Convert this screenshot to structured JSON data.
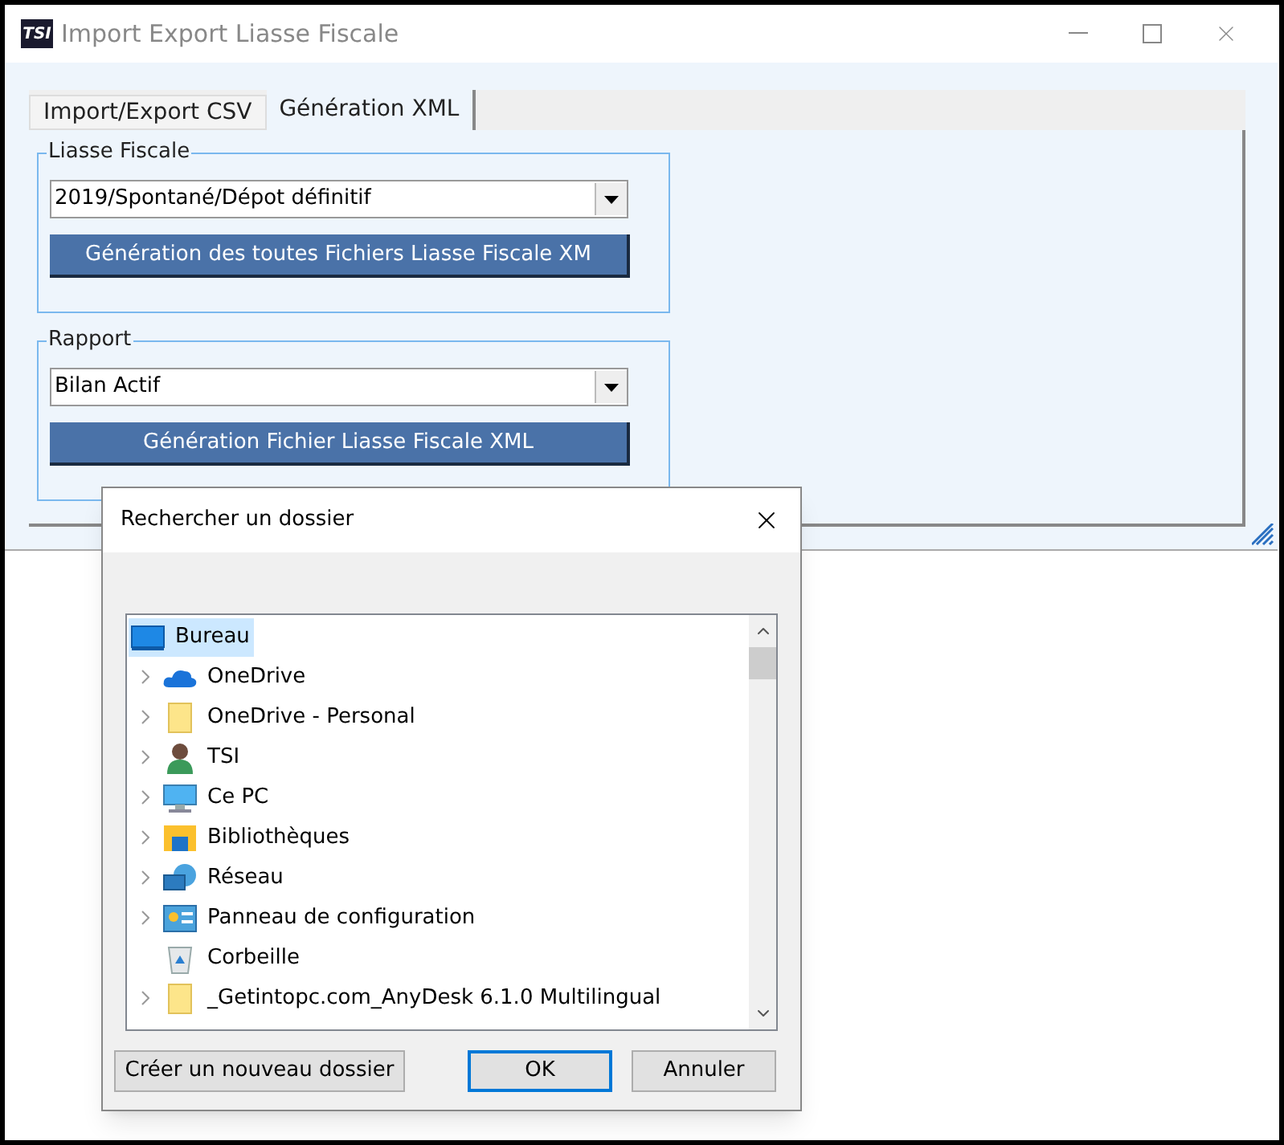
{
  "window": {
    "title": "Import Export Liasse Fiscale",
    "logo": "TSI"
  },
  "tabs": [
    {
      "label": "Import/Export CSV",
      "selected": false
    },
    {
      "label": "Génération XML",
      "selected": true
    }
  ],
  "groups": [
    {
      "legend": "Liasse Fiscale",
      "select_value": "2019/Spontané/Dépot définitif",
      "button": "Génération des toutes Fichiers Liasse Fiscale XM"
    },
    {
      "legend": "Rapport",
      "select_value": "Bilan Actif",
      "button": "Génération Fichier Liasse Fiscale XML"
    }
  ],
  "dialog": {
    "title": "Rechercher un dossier",
    "tree": [
      {
        "label": "Bureau",
        "kind": "desktop",
        "expandable": false,
        "selected": true
      },
      {
        "label": "OneDrive",
        "kind": "cloud",
        "expandable": true,
        "selected": false
      },
      {
        "label": "OneDrive - Personal",
        "kind": "folder",
        "expandable": true,
        "selected": false
      },
      {
        "label": "TSI",
        "kind": "user",
        "expandable": true,
        "selected": false
      },
      {
        "label": "Ce PC",
        "kind": "computer",
        "expandable": true,
        "selected": false
      },
      {
        "label": "Bibliothèques",
        "kind": "library",
        "expandable": true,
        "selected": false
      },
      {
        "label": "Réseau",
        "kind": "network",
        "expandable": true,
        "selected": false
      },
      {
        "label": "Panneau de configuration",
        "kind": "control",
        "expandable": true,
        "selected": false
      },
      {
        "label": "Corbeille",
        "kind": "trash",
        "expandable": false,
        "selected": false
      },
      {
        "label": "_Getintopc.com_AnyDesk 6.1.0 Multilingual",
        "kind": "folder",
        "expandable": true,
        "selected": false
      }
    ],
    "buttons": [
      {
        "label": "Créer un nouveau dossier",
        "kind": "normal"
      },
      {
        "label": "OK",
        "kind": "default"
      },
      {
        "label": "Annuler",
        "kind": "normal"
      }
    ]
  }
}
